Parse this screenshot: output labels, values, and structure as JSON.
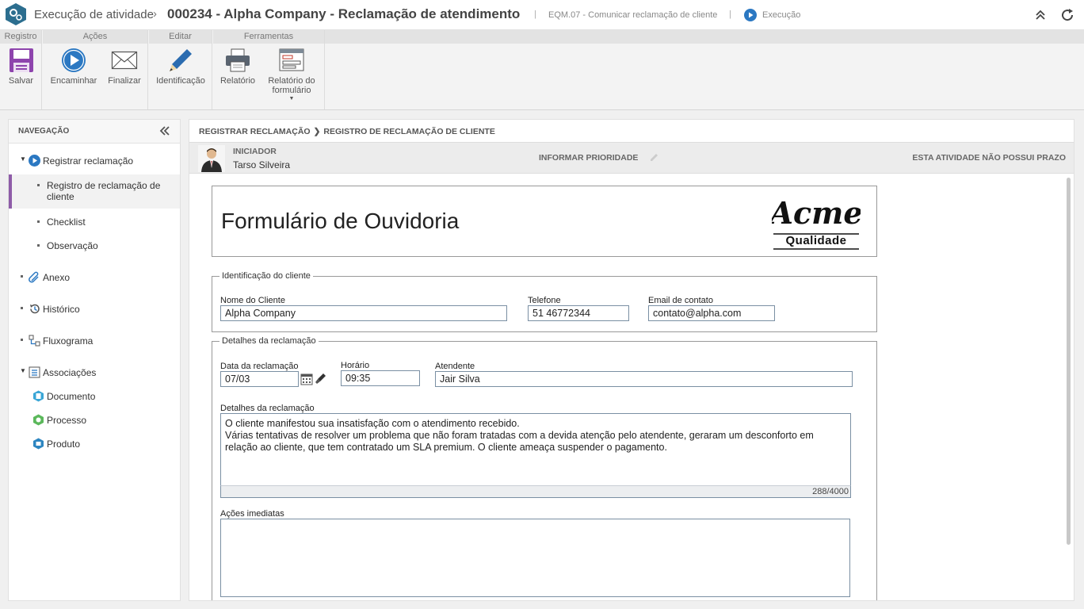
{
  "header": {
    "app_title": "Execução de atividade",
    "doc_title": "000234 - Alpha Company - Reclamação de atendimento",
    "process_code": "EQM.07 - Comunicar reclamação de cliente",
    "status": "Execução",
    "separator": "|"
  },
  "ribbon": {
    "groups": [
      {
        "label": "Registro",
        "buttons": [
          {
            "label": "Salvar",
            "icon": "save-icon"
          }
        ]
      },
      {
        "label": "Ações",
        "buttons": [
          {
            "label": "Encaminhar",
            "icon": "play-icon"
          },
          {
            "label": "Finalizar",
            "icon": "envelope-icon"
          }
        ]
      },
      {
        "label": "Editar",
        "buttons": [
          {
            "label": "Identificação",
            "icon": "pencil-icon"
          }
        ]
      },
      {
        "label": "Ferramentas",
        "buttons": [
          {
            "label": "Relatório",
            "icon": "printer-icon"
          },
          {
            "label": "Relatório do formulário",
            "icon": "form-report-icon"
          }
        ]
      }
    ]
  },
  "navigation": {
    "title": "NAVEGAÇÃO",
    "items": [
      {
        "label": "Registrar reclamação",
        "icon": "play-circle-icon"
      },
      {
        "label": "Registro de reclamação de cliente",
        "active": true
      },
      {
        "label": "Checklist"
      },
      {
        "label": "Observação"
      },
      {
        "label": "Anexo",
        "icon": "paperclip-icon"
      },
      {
        "label": "Histórico",
        "icon": "history-icon"
      },
      {
        "label": "Fluxograma",
        "icon": "flowchart-icon"
      },
      {
        "label": "Associações",
        "icon": "associations-icon"
      },
      {
        "label": "Documento",
        "icon": "document-icon"
      },
      {
        "label": "Processo",
        "icon": "process-icon"
      },
      {
        "label": "Produto",
        "icon": "product-icon"
      }
    ]
  },
  "main": {
    "breadcrumb": [
      "REGISTRAR RECLAMAÇÃO",
      "REGISTRO DE RECLAMAÇÃO DE CLIENTE"
    ],
    "initiator_label": "INICIADOR",
    "initiator_name": "Tarso Silveira",
    "priority_label": "INFORMAR PRIORIDADE",
    "deadline_label": "ESTA ATIVIDADE NÃO POSSUI PRAZO"
  },
  "form": {
    "title": "Formulário de Ouvidoria",
    "logo_text": "Acme",
    "logo_subtext": "Qualidade",
    "client_section": {
      "legend": "Identificação do cliente",
      "name_label": "Nome do Cliente",
      "name_value": "Alpha Company",
      "phone_label": "Telefone",
      "phone_value": "51 46772344",
      "email_label": "Email de contato",
      "email_value": "contato@alpha.com"
    },
    "complaint_section": {
      "legend": "Detalhes da reclamação",
      "date_label": "Data da reclamação",
      "date_value": "07/03",
      "time_label": "Horário",
      "time_value": "09:35",
      "agent_label": "Atendente",
      "agent_value": "Jair Silva",
      "details_label": "Detalhes da reclamação",
      "details_line1": "O cliente manifestou sua insatisfação com o atendimento recebido.",
      "details_line2": "Várias tentativas de resolver um problema que não foram tratadas com a devida atenção pelo atendente, geraram um desconforto em relação ao cliente, que tem contratado um SLA premium. O cliente ameaça suspender o pagamento.",
      "details_counter": "288/4000",
      "actions_label": "Ações imediatas",
      "actions_value": ""
    }
  }
}
